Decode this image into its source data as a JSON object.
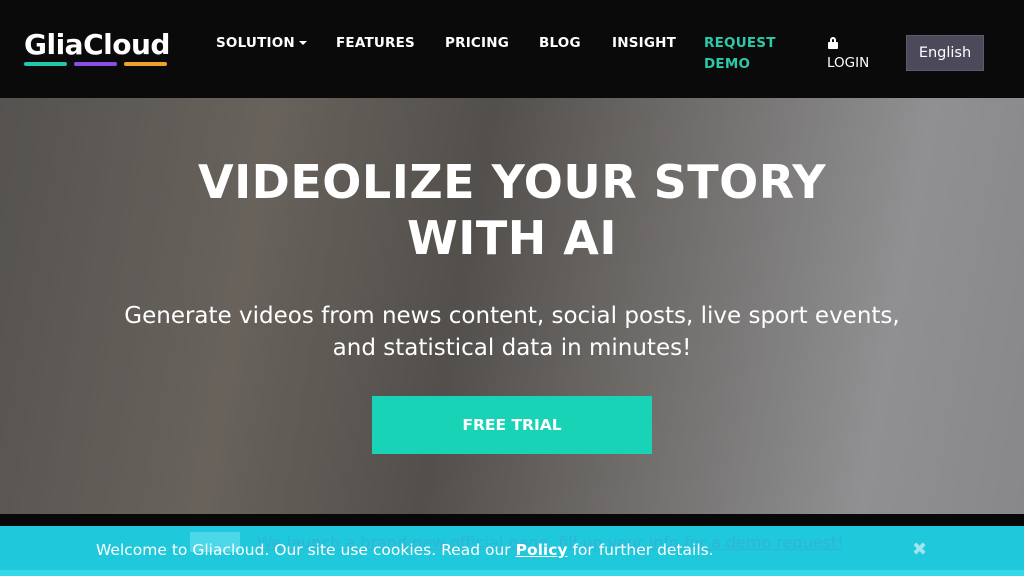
{
  "brand": {
    "name": "GliaCloud",
    "bar_colors": [
      "#21c9a8",
      "#8a4fe8",
      "#f0a22a"
    ]
  },
  "nav": {
    "items": [
      "SOLUTION",
      "FEATURES",
      "PRICING",
      "BLOG",
      "INSIGHT"
    ],
    "request_demo": [
      "REQUEST",
      "DEMO"
    ],
    "login": "LOGIN",
    "language": "English",
    "accent": "#2dc9a8"
  },
  "hero": {
    "title_line1": "VIDEOLIZE YOUR STORY",
    "title_line2": "WITH AI",
    "subtitle_line1": "Generate videos from news content, social posts, live sport events,",
    "subtitle_line2": "and statistical data in minutes!",
    "cta": "FREE TRIAL",
    "cta_color": "#19d3b6"
  },
  "announcement": {
    "text": "We launch a brand new official page, fill up your info for a demo request!"
  },
  "cookie": {
    "before": "Welcome to Gliacloud. Our site use cookies. Read our ",
    "link": "Policy",
    "after": " for further details.",
    "close": "✖",
    "color": "#1fc8da"
  }
}
